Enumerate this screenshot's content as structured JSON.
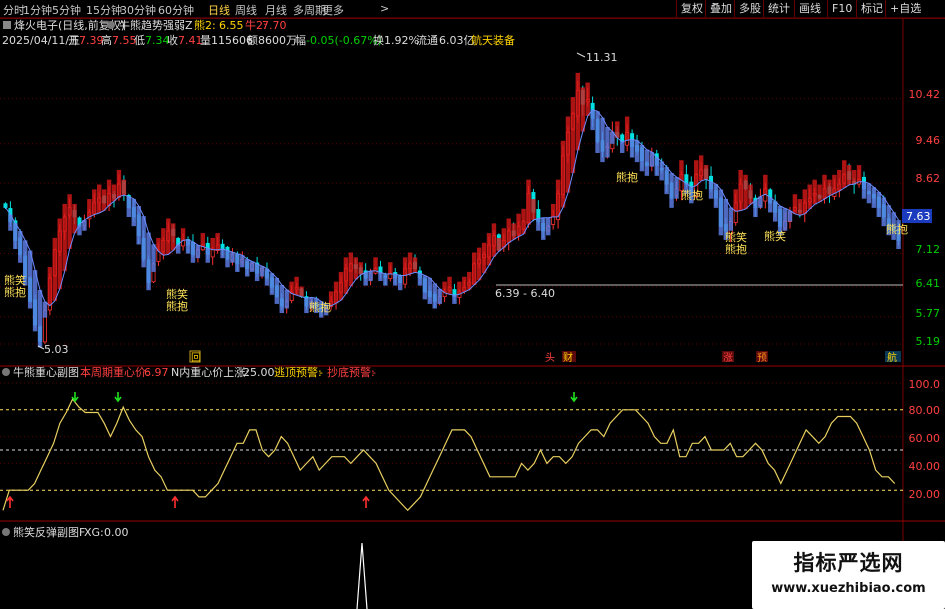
{
  "toolbar": {
    "periods": [
      "分时",
      "1分钟",
      "5分钟",
      "15分钟",
      "30分钟",
      "60分钟",
      "日线",
      "周线",
      "月线",
      "多周期",
      "更多"
    ],
    "active": "日线",
    "more_arrow": ">",
    "right_buttons": [
      "复权",
      "叠加",
      "多股",
      "统计",
      "画线",
      "F10",
      "标记",
      "+自选"
    ],
    "back_arrow": "返回"
  },
  "header": {
    "stock": "烽火电子(日线,前复权)",
    "indicator": "牛熊趋势强弱Z",
    "bear_label": "熊2:",
    "bear_value": "6.55",
    "bull_label": "牛2:",
    "bull_value": "7.70",
    "date": "2025/04/11/五",
    "open_label": "开",
    "open": "7.39",
    "high_label": "高",
    "high": "7.55",
    "low_label": "低",
    "low": "7.34",
    "close_label": "收",
    "close": "7.41",
    "vol_label": "量",
    "vol": "115606",
    "amt_label": "额",
    "amt": "8600万",
    "chg_label": "幅",
    "chg": "-0.05(-0.67%)",
    "turn_label": "换",
    "turn": "1.92%",
    "float_label": "流通",
    "float": "6.03亿",
    "concept": "航天装备"
  },
  "main_chart": {
    "price_axis": [
      "10.42",
      "9.46",
      "8.62",
      "7.12",
      "6.41",
      "5.77",
      "5.19"
    ],
    "current_price": "7.63",
    "max_label": "11.31",
    "min_label": "5.03",
    "range_label": "6.39 - 6.40",
    "signals": [
      "熊笑",
      "熊抱",
      "熊笑",
      "熊抱",
      "熊抱",
      "熊抱",
      "熊抱",
      "熊笑",
      "熊抱",
      "熊笑",
      "熊抱"
    ],
    "bottom_marks": [
      "回",
      "头",
      "财",
      "涨",
      "预",
      "航"
    ]
  },
  "sub1": {
    "title": "牛熊重心副图",
    "week_label": "本周期重心价:",
    "week_value": "6.97",
    "n_label": "N内重心价上涨:",
    "n_value": "25.00",
    "escape_label": "逃顶预警:",
    "escape_value": "-",
    "bottom_label": "抄底预警:",
    "bottom_value": "-",
    "axis": [
      "100.0",
      "80.00",
      "60.00",
      "40.00",
      "20.00"
    ]
  },
  "sub2": {
    "title": "熊笑反弹副图F",
    "xg_label": "XG:",
    "xg_value": "0.00"
  },
  "watermark": {
    "title": "指标严选网",
    "url": "www.xuezhibiao.com"
  },
  "chart_data": {
    "type": "candlestick",
    "title": "烽火电子(日线,前复权)",
    "y_ticks": [
      10.42,
      9.46,
      8.62,
      7.12,
      6.41,
      5.77,
      5.19
    ],
    "ylim": [
      4.85,
      11.5
    ],
    "closes": [
      8.1,
      7.8,
      7.4,
      7.1,
      6.6,
      6.1,
      5.6,
      5.25,
      5.9,
      6.6,
      7.2,
      7.6,
      7.9,
      8.1,
      7.9,
      7.7,
      7.8,
      8.0,
      8.2,
      8.3,
      8.2,
      8.4,
      8.3,
      8.6,
      8.4,
      8.1,
      7.9,
      7.5,
      7.0,
      6.5,
      6.9,
      7.2,
      7.4,
      7.6,
      7.5,
      7.3,
      7.4,
      7.3,
      7.1,
      7.2,
      7.3,
      7.1,
      7.2,
      7.3,
      7.2,
      7.0,
      7.1,
      6.9,
      7.0,
      6.8,
      6.9,
      6.7,
      6.8,
      6.6,
      6.4,
      6.2,
      6.0,
      6.1,
      6.3,
      6.4,
      6.2,
      6.0,
      6.1,
      6.0,
      5.9,
      5.95,
      6.1,
      6.3,
      6.5,
      6.8,
      6.9,
      6.8,
      6.7,
      6.6,
      6.7,
      6.8,
      6.7,
      6.6,
      6.7,
      6.6,
      6.5,
      6.8,
      6.9,
      6.8,
      6.6,
      6.3,
      6.2,
      6.1,
      6.2,
      6.3,
      6.4,
      6.2,
      6.3,
      6.4,
      6.5,
      6.9,
      7.0,
      7.1,
      7.3,
      7.5,
      7.2,
      7.4,
      7.6,
      7.5,
      7.7,
      7.8,
      8.4,
      8.0,
      7.8,
      7.6,
      7.7,
      7.9,
      8.4,
      9.2,
      9.7,
      10.1,
      10.6,
      10.3,
      10.4,
      10.0,
      9.5,
      9.3,
      9.4,
      9.7,
      9.6,
      9.5,
      9.7,
      9.4,
      9.3,
      9.1,
      9.0,
      9.2,
      9.0,
      8.9,
      8.6,
      8.3,
      8.5,
      8.8,
      8.6,
      8.4,
      8.8,
      8.9,
      8.7,
      8.5,
      8.3,
      7.7,
      7.6,
      7.8,
      8.2,
      8.6,
      8.5,
      8.3,
      8.1,
      8.3,
      8.5,
      8.2,
      8.0,
      7.7,
      7.8,
      8.0,
      8.1,
      8.0,
      8.2,
      8.3,
      8.4,
      8.3,
      8.5,
      8.4,
      8.5,
      8.6,
      8.8,
      8.7,
      8.6,
      8.7,
      8.5,
      8.4,
      8.3,
      8.1,
      7.9,
      7.7,
      7.6,
      7.4
    ]
  },
  "sub1_data": {
    "type": "line",
    "ylim": [
      0,
      100
    ],
    "values": [
      5,
      20,
      20,
      20,
      20,
      25,
      35,
      45,
      55,
      70,
      78,
      88,
      82,
      78,
      78,
      78,
      70,
      60,
      70,
      82,
      72,
      65,
      60,
      45,
      35,
      30,
      20,
      20,
      20,
      20,
      20,
      15,
      15,
      20,
      25,
      35,
      45,
      55,
      55,
      65,
      65,
      50,
      45,
      50,
      60,
      55,
      45,
      35,
      40,
      45,
      35,
      40,
      45,
      45,
      45,
      40,
      45,
      50,
      45,
      40,
      30,
      20,
      15,
      10,
      5,
      10,
      15,
      25,
      35,
      45,
      55,
      65,
      65,
      65,
      60,
      50,
      40,
      30,
      30,
      30,
      30,
      30,
      40,
      35,
      40,
      50,
      40,
      45,
      45,
      40,
      45,
      55,
      60,
      65,
      65,
      60,
      70,
      75,
      80,
      80,
      80,
      75,
      70,
      60,
      55,
      55,
      65,
      45,
      45,
      55,
      55,
      60,
      50,
      50,
      50,
      55,
      45,
      45,
      50,
      55,
      50,
      40,
      35,
      25,
      35,
      45,
      55,
      65,
      60,
      55,
      60,
      70,
      75,
      75,
      75,
      70,
      60,
      50,
      35,
      30,
      30,
      25
    ]
  }
}
